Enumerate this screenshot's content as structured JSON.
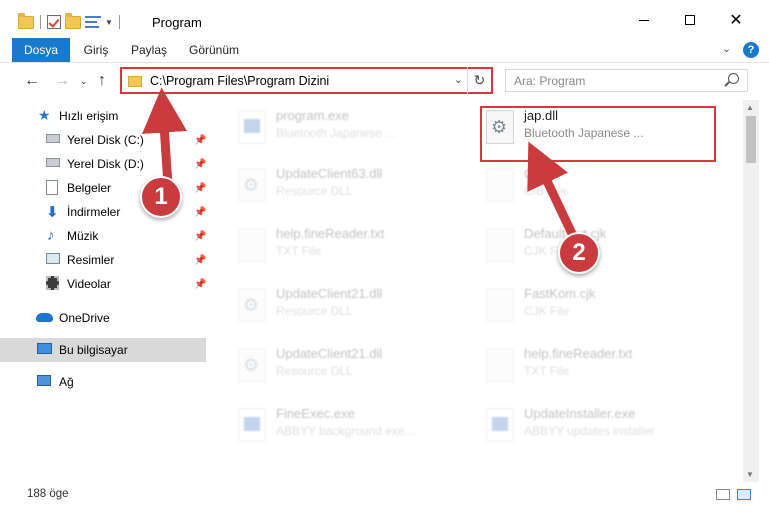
{
  "window": {
    "title": "Program"
  },
  "ribbon": {
    "tabs": [
      "Dosya",
      "Giriş",
      "Paylaş",
      "Görünüm"
    ]
  },
  "address": {
    "path": "C:\\Program Files\\Program Dizini"
  },
  "search": {
    "placeholder": "Ara: Program"
  },
  "sidebar": {
    "items": [
      {
        "label": "Hızlı erişim",
        "icon": "star-icon",
        "pinned": false
      },
      {
        "label": "Yerel Disk (C:)",
        "icon": "drive-icon",
        "pinned": true
      },
      {
        "label": "Yerel Disk (D:)",
        "icon": "drive-icon",
        "pinned": true
      },
      {
        "label": "Belgeler",
        "icon": "document-icon",
        "pinned": true
      },
      {
        "label": "İndirmeler",
        "icon": "download-icon",
        "pinned": true
      },
      {
        "label": "Müzik",
        "icon": "music-icon",
        "pinned": true
      },
      {
        "label": "Resimler",
        "icon": "pictures-icon",
        "pinned": true
      },
      {
        "label": "Videolar",
        "icon": "video-icon",
        "pinned": true
      },
      {
        "label": "OneDrive",
        "icon": "cloud-icon",
        "pinned": false
      },
      {
        "label": "Bu bilgisayar",
        "icon": "computer-icon",
        "pinned": false,
        "selected": true
      },
      {
        "label": "Ağ",
        "icon": "network-icon",
        "pinned": false
      }
    ]
  },
  "files": [
    {
      "name": "program.exe",
      "type": "Bluetooth Japanese ...",
      "icon": "exe-icon",
      "faded": true
    },
    {
      "name": "jap.dll",
      "type": "Bluetooth Japanese ...",
      "icon": "gear-file-icon",
      "faded": false,
      "highlighted": true
    },
    {
      "name": "UpdateClient63.dll",
      "type": "Resource DLL",
      "icon": "blank-file-icon",
      "faded": true
    },
    {
      "name": "Calib",
      "type": "CIB File",
      "icon": "blank-file-icon",
      "faded": true
    },
    {
      "name": "help.fineReader.txt",
      "type": "TXT File",
      "icon": "blank-file-icon",
      "faded": true
    },
    {
      "name": "Default.out.cjk",
      "type": "CJK File",
      "icon": "blank-file-icon",
      "faded": true
    },
    {
      "name": "UpdateClient21.dll",
      "type": "Resource DLL",
      "icon": "gear-file-icon",
      "faded": true
    },
    {
      "name": "FastKom.cjk",
      "type": "CJK File",
      "icon": "blank-file-icon",
      "faded": true
    },
    {
      "name": "UpdateClient21.dll",
      "type": "Resource DLL",
      "icon": "gear-file-icon",
      "faded": true
    },
    {
      "name": "help.fineReader.txt",
      "type": "TXT File",
      "icon": "blank-file-icon",
      "faded": true
    },
    {
      "name": "FineExec.exe",
      "type": "ABBYY background exe...",
      "icon": "exe-icon",
      "faded": true
    },
    {
      "name": "UpdateInstaller.exe",
      "type": "ABBYY updates installer",
      "icon": "exe-icon",
      "faded": true
    }
  ],
  "status": {
    "count": "188 öge"
  },
  "annotations": {
    "step1": "1",
    "step2": "2",
    "color": "#c93b3e"
  }
}
